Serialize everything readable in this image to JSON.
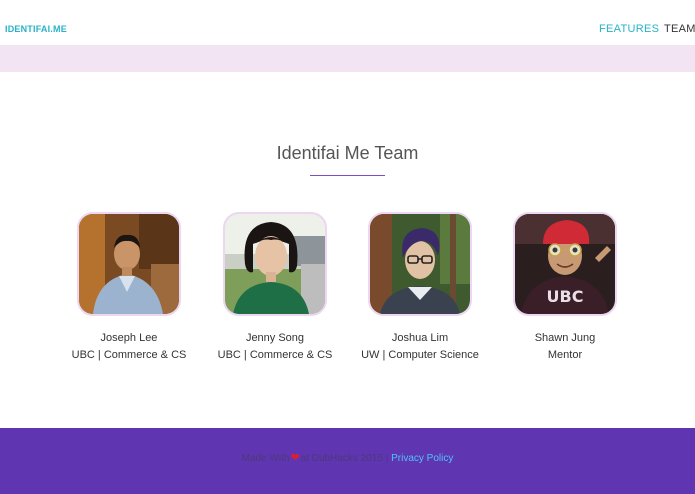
{
  "colors": {
    "accent": "#26b3c7",
    "band": "#f3e4f4",
    "rule": "#7a4fbf",
    "photo_border": "#ecd6f2",
    "footer_bg": "#6035b1",
    "link": "#4fc3f7",
    "nav_text": "#333333"
  },
  "nav": {
    "brand": "IDENTIFAI.ME",
    "links": [
      "FEATURES",
      "TEAM"
    ]
  },
  "team": {
    "title": "Identifai Me Team",
    "members": [
      {
        "name": "Joseph Lee",
        "role": "UBC | Commerce & CS",
        "photo": "photo-joseph"
      },
      {
        "name": "Jenny Song",
        "role": "UBC | Commerce & CS",
        "photo": "photo-jenny"
      },
      {
        "name": "Joshua Lim",
        "role": "UW | Computer Science",
        "photo": "photo-joshua"
      },
      {
        "name": "Shawn Jung",
        "role": "Mentor",
        "photo": "photo-shawn"
      }
    ]
  },
  "footer": {
    "made_with": "Made With",
    "heart_icon": "heart-icon",
    "at_text": "at DubHacks 2015 |",
    "privacy_link": "Privacy Policy"
  }
}
